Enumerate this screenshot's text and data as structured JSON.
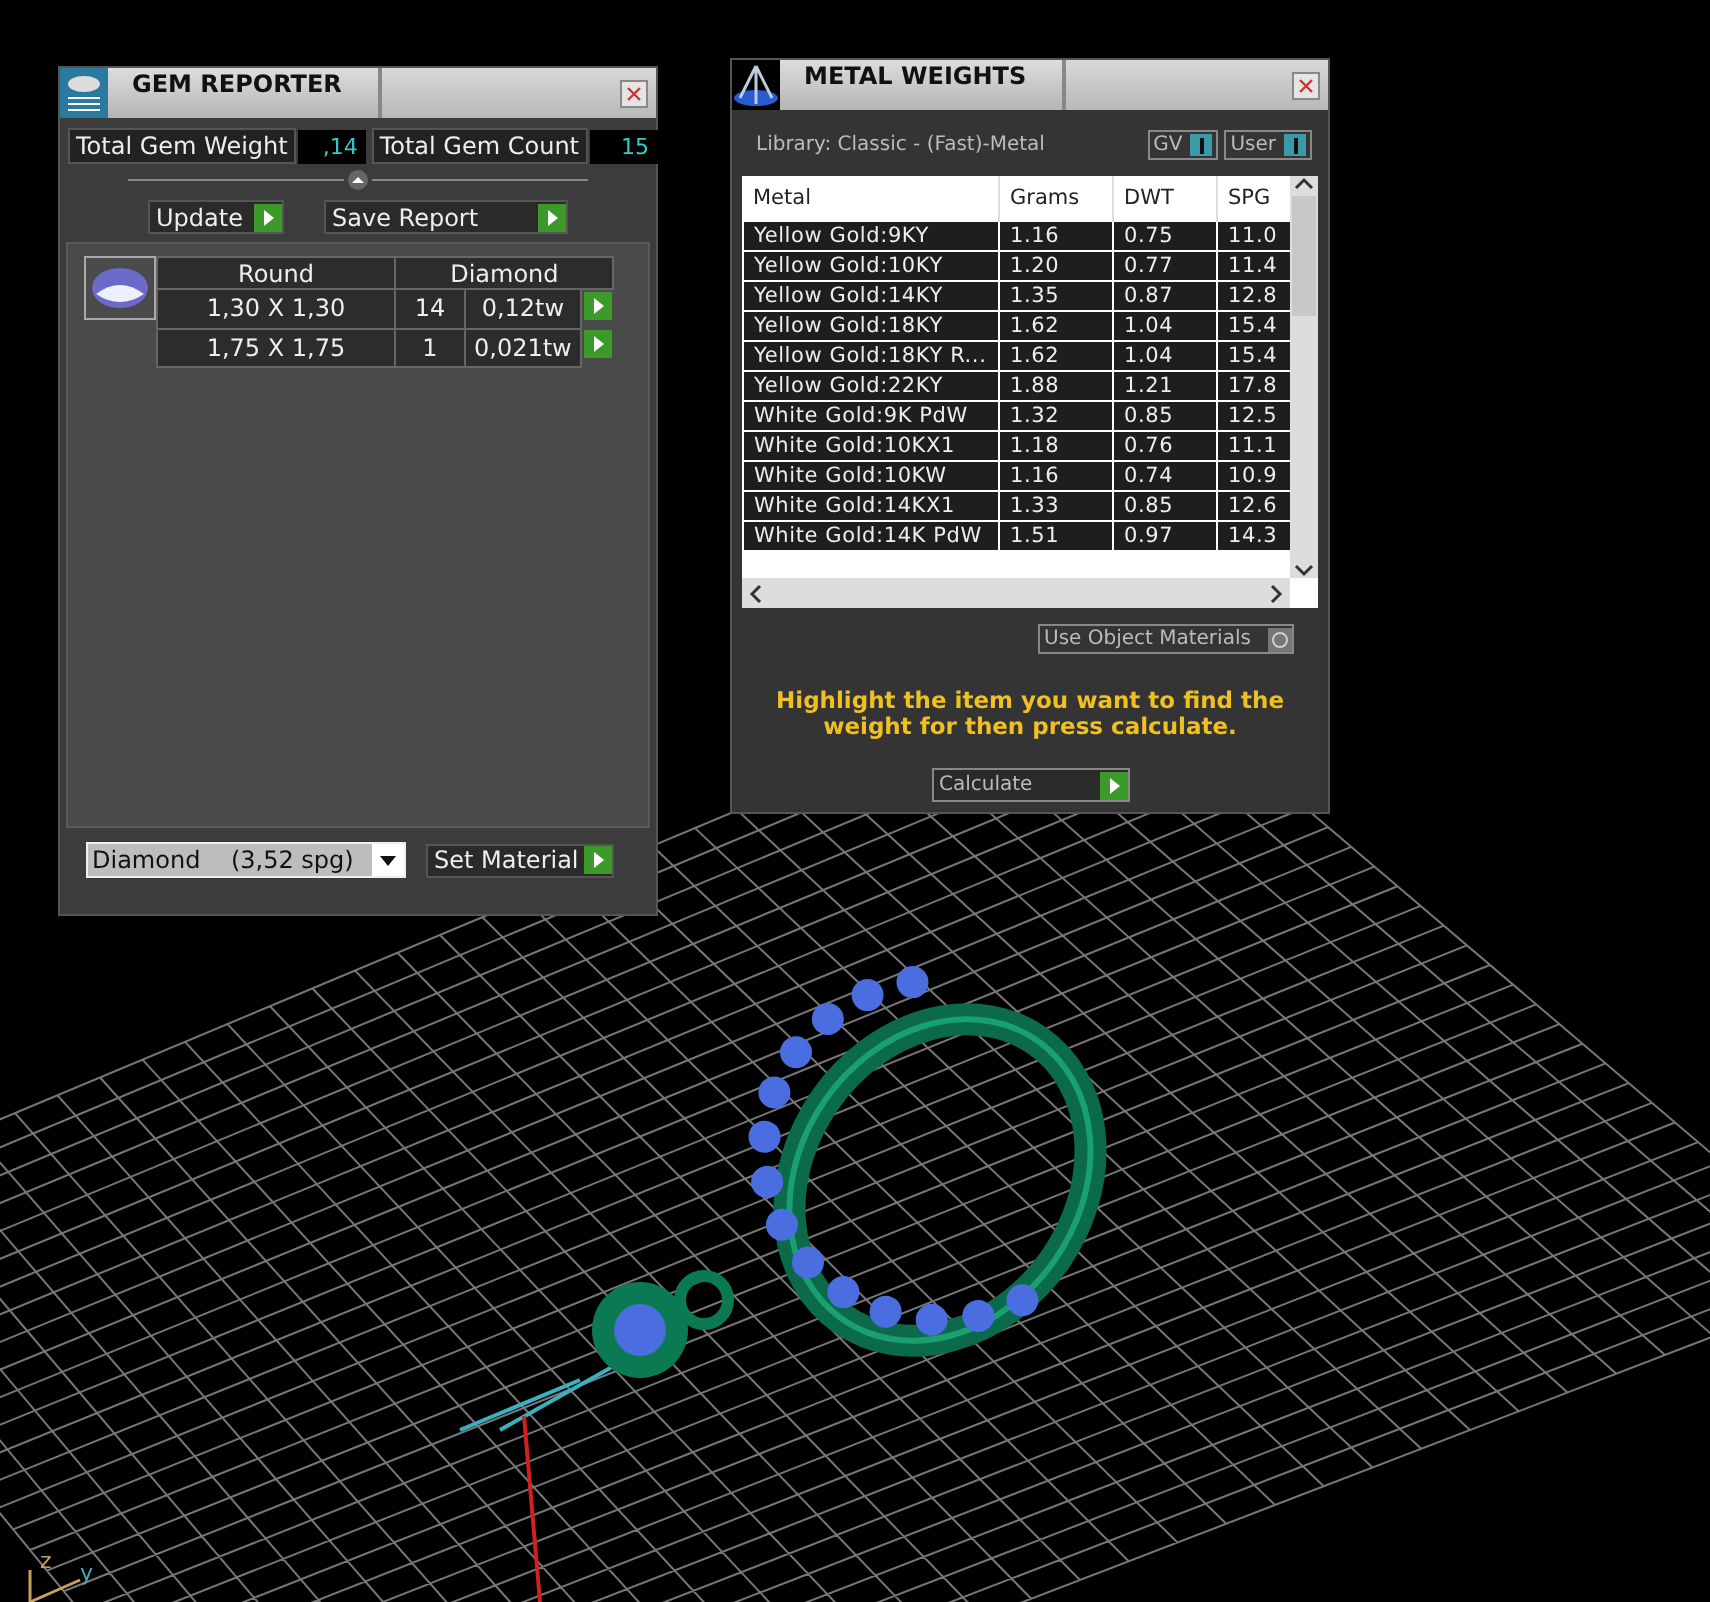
{
  "gem_reporter": {
    "title": "GEM REPORTER",
    "totals": [
      {
        "label": "Total Gem Weight",
        "value": ",14"
      },
      {
        "label": "Total Gem Count",
        "value": "15"
      }
    ],
    "buttons": [
      "Update",
      "Save Report"
    ],
    "table": {
      "headers": [
        "Round",
        "Diamond"
      ],
      "rows": [
        {
          "size": "1,30 X 1,30",
          "count": "14",
          "weight": "0,12tw"
        },
        {
          "size": "1,75 X 1,75",
          "count": "1",
          "weight": "0,021tw"
        }
      ]
    },
    "material": "Diamond    (3,52 spg)",
    "set_material": "Set Material"
  },
  "metal_weights": {
    "title": "METAL WEIGHTS",
    "library": "Library: Classic - (Fast)-Metal",
    "toggles": [
      {
        "label": "GV",
        "on": true
      },
      {
        "label": "User",
        "on": true
      }
    ],
    "columns": [
      "Metal",
      "Grams",
      "DWT",
      "SPG"
    ],
    "rows": [
      [
        "Yellow Gold:9KY",
        "1.16",
        "0.75",
        "11.0"
      ],
      [
        "Yellow Gold:10KY",
        "1.20",
        "0.77",
        "11.4"
      ],
      [
        "Yellow Gold:14KY",
        "1.35",
        "0.87",
        "12.8"
      ],
      [
        "Yellow Gold:18KY",
        "1.62",
        "1.04",
        "15.4"
      ],
      [
        "Yellow Gold:18KY R...",
        "1.62",
        "1.04",
        "15.4"
      ],
      [
        "Yellow Gold:22KY",
        "1.88",
        "1.21",
        "17.8"
      ],
      [
        "White Gold:9K PdW",
        "1.32",
        "0.85",
        "12.5"
      ],
      [
        "White Gold:10KX1",
        "1.18",
        "0.76",
        "11.1"
      ],
      [
        "White Gold:10KW",
        "1.16",
        "0.74",
        "10.9"
      ],
      [
        "White Gold:14KX1",
        "1.33",
        "0.85",
        "12.6"
      ],
      [
        "White Gold:14K PdW",
        "1.51",
        "0.97",
        "14.3"
      ]
    ],
    "use_object_materials": {
      "label": "Use Object Materials",
      "checked": false
    },
    "hint": "Highlight the item you want to find the weight for then press calculate.",
    "calculate": "Calculate"
  },
  "viewport": {
    "axis_labels": [
      "z",
      "y"
    ]
  }
}
